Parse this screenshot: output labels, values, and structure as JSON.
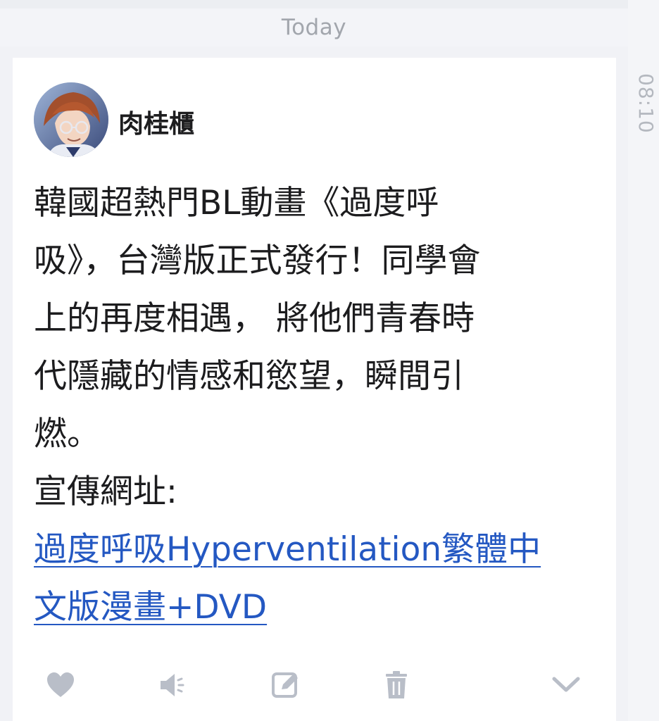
{
  "date_header": "Today",
  "timestamp": "08:10",
  "post": {
    "author": "肉桂櫃",
    "lines": [
      "韓國超熱門BL動畫《過度呼",
      "吸》，台灣版正式發行！同學會",
      "上的再度相遇， 將他們青春時",
      "代隱藏的情感和慾望，瞬間引",
      "燃。",
      "宣傳網址:"
    ],
    "link_lines": [
      "過度呼吸Hyperventilation繁體中",
      "文版漫畫+DVD"
    ]
  },
  "actions": {
    "like_icon": "heart-icon",
    "speak_icon": "speaker-icon",
    "edit_icon": "edit-icon",
    "delete_icon": "trash-icon",
    "more_icon": "chevron-down-icon"
  },
  "colors": {
    "link": "#2458c2",
    "icon": "#b9bec8",
    "date_text": "#a2a6ad"
  }
}
